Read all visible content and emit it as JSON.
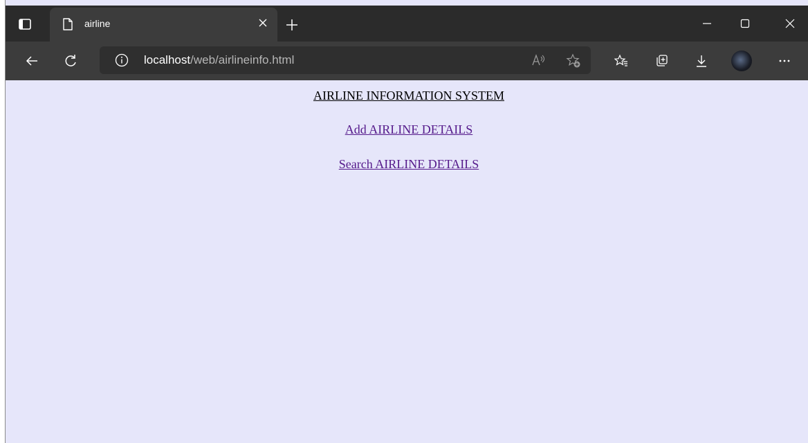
{
  "browser": {
    "tab": {
      "title": "airline"
    },
    "address_bar": {
      "host": "localhost",
      "path": "/web/airlineinfo.html"
    }
  },
  "page": {
    "title": "AIRLINE INFORMATION SYSTEM",
    "links": [
      {
        "label": "Add AIRLINE DETAILS"
      },
      {
        "label": "Search AIRLINE DETAILS"
      }
    ]
  },
  "colors": {
    "page_background": "#e6e6fa",
    "visited_link": "#551a8b",
    "titlebar": "#2b2b2b",
    "toolbar": "#3c3c3c"
  }
}
